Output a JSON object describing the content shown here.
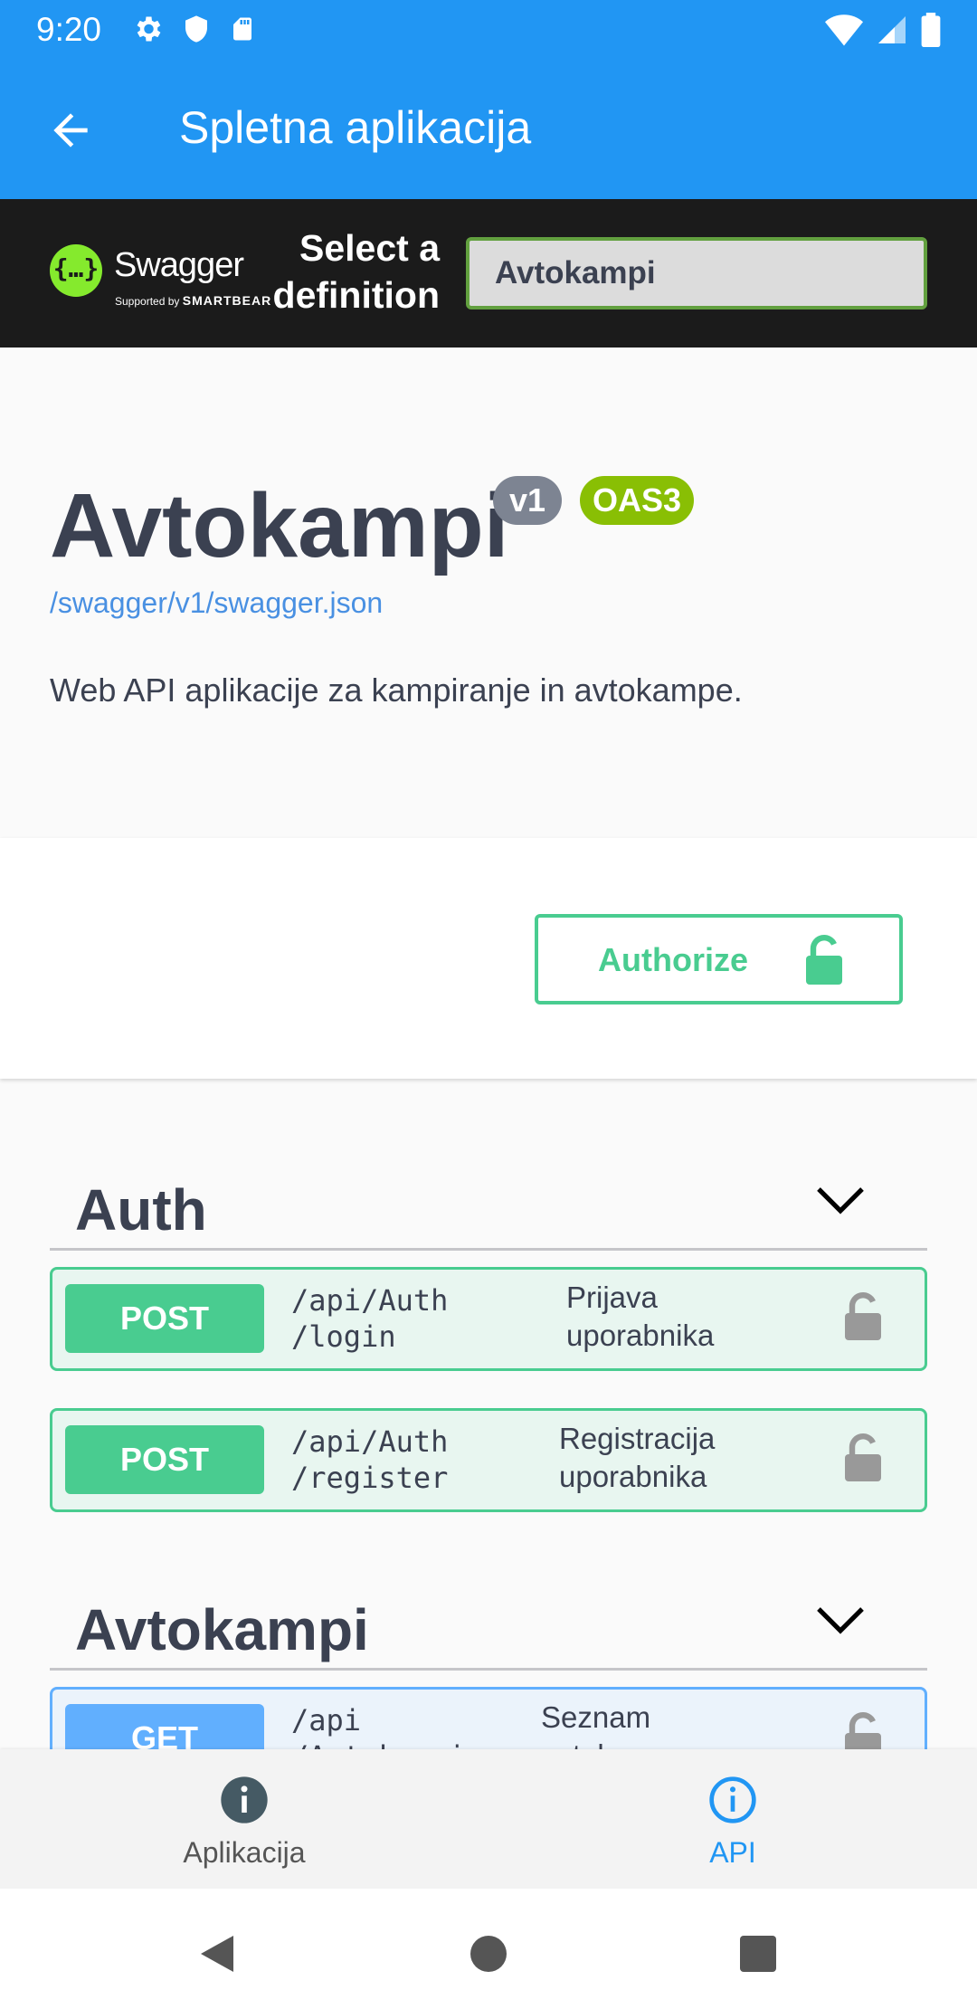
{
  "status_bar": {
    "time": "9:20"
  },
  "app_bar": {
    "title": "Spletna aplikacija"
  },
  "swagger_bar": {
    "logo_text": "Swagger",
    "logo_sub_prefix": "Supported by",
    "logo_sub_brand": "SMARTBEAR",
    "select_label_line1": "Select a",
    "select_label_line2": "definition",
    "selected_definition": "Avtokampi"
  },
  "info": {
    "title": "Avtokampi",
    "version_badge": "v1",
    "spec_badge": "OAS3",
    "spec_url": "/swagger/v1/swagger.json",
    "description": "Web API aplikacije za kampiranje in avtokampe."
  },
  "scheme": {
    "authorize_label": "Authorize"
  },
  "groups": [
    {
      "name": "Auth",
      "operations": [
        {
          "method": "POST",
          "path_line1": "/api/Auth",
          "path_line2": "/login",
          "summary_line1": "Prijava",
          "summary_line2": "uporabnika"
        },
        {
          "method": "POST",
          "path_line1": "/api/Auth",
          "path_line2": "/register",
          "summary_line1": "Registracija",
          "summary_line2": "uporabnika"
        }
      ]
    },
    {
      "name": "Avtokampi",
      "operations": [
        {
          "method": "GET",
          "path_line1": "/api",
          "path_line2": "/Avtokampi",
          "summary_line1": "Seznam",
          "summary_line2": "avtokampov"
        }
      ]
    }
  ],
  "bottom_nav": {
    "items": [
      {
        "label": "Aplikacija",
        "icon": "info-filled-icon",
        "active": false
      },
      {
        "label": "API",
        "icon": "info-outline-icon",
        "active": true
      }
    ]
  },
  "colors": {
    "primary": "#2196f3",
    "post": "#49cc90",
    "get": "#61affe",
    "swagger_green": "#85ea2d",
    "oas_badge": "#89bf04"
  }
}
